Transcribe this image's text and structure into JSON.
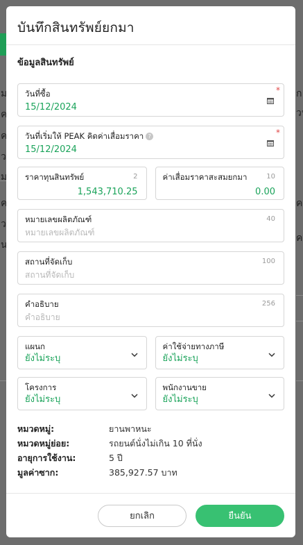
{
  "background": {
    "left_fragments": [
      "ม",
      "ค",
      "ค",
      "ว",
      "ม",
      "ค",
      "ว",
      "น"
    ],
    "right_fragments": [
      "ก",
      "วน",
      "ค",
      "ค"
    ]
  },
  "modal": {
    "title": "บันทึกสินทรัพย์ยกมา",
    "section_title": "ข้อมูลสินทรัพย์",
    "purchase_date": {
      "label": "วันที่ซื้อ",
      "value": "15/12/2024",
      "required_mark": "*"
    },
    "depreciation_start": {
      "label": "วันที่เริ่มให้ PEAK คิดค่าเสื่อมราคา",
      "value": "15/12/2024",
      "required_mark": "*",
      "info_glyph": "?"
    },
    "asset_cost": {
      "label": "ราคาทุนสินทรัพย์",
      "counter": "2",
      "value": "1,543,710.25"
    },
    "accum_depreciation": {
      "label": "ค่าเสื่อมราคาสะสมยกมา",
      "counter": "10",
      "value": "0.00"
    },
    "serial_number": {
      "label": "หมายเลขผลิตภัณฑ์",
      "counter": "40",
      "placeholder": "หมายเลขผลิตภัณฑ์"
    },
    "storage_location": {
      "label": "สถานที่จัดเก็บ",
      "counter": "100",
      "placeholder": "สถานที่จัดเก็บ"
    },
    "description": {
      "label": "คำอธิบาย",
      "counter": "256",
      "placeholder": "คำอธิบาย"
    },
    "department": {
      "label": "แผนก",
      "value": "ยังไม่ระบุ"
    },
    "tax_expense": {
      "label": "ค่าใช้จ่ายทางภาษี",
      "value": "ยังไม่ระบุ"
    },
    "project": {
      "label": "โครงการ",
      "value": "ยังไม่ระบุ"
    },
    "salesperson": {
      "label": "พนักงานขาย",
      "value": "ยังไม่ระบุ"
    },
    "info": [
      {
        "key": "หมวดหมู่:",
        "value": "ยานพาหนะ"
      },
      {
        "key": "หมวดหมู่ย่อย:",
        "value": "รถยนต์นั่งไม่เกิน 10 ที่นั่ง"
      },
      {
        "key": "อายุการใช้งาน:",
        "value": "5 ปี"
      },
      {
        "key": "มูลค่าซาก:",
        "value": "385,927.57 บาท"
      }
    ],
    "cancel_label": "ยกเลิก",
    "confirm_label": "ยืนยัน"
  }
}
